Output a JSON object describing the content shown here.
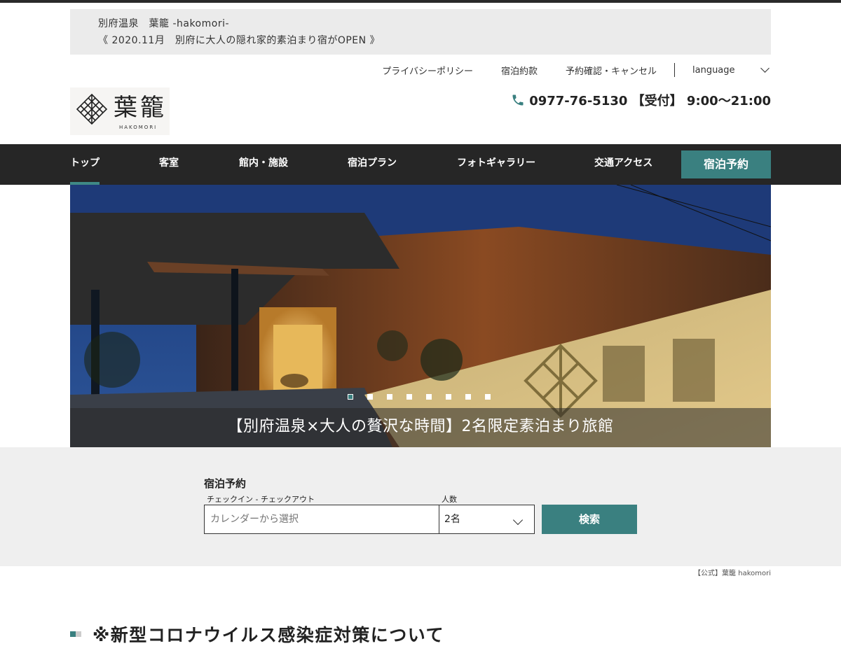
{
  "notice": {
    "line1": "別府温泉　葉籠 -hakomori-",
    "line2": "《 2020.11月　別府に大人の隠れ家的素泊まり宿がOPEN 》"
  },
  "utility": {
    "links": [
      "プライバシーポリシー",
      "宿泊約款",
      "予約確認・キャンセル"
    ],
    "language": "language"
  },
  "logo": {
    "kanji": "葉籠",
    "roman": "HAKOMORI"
  },
  "phone": {
    "text": "0977-76-5130 【受付】 9:00〜21:00",
    "icon": "phone-icon"
  },
  "nav": {
    "items": [
      "トップ",
      "客室",
      "館内・施設",
      "宿泊プラン",
      "フォトギャラリー",
      "交通アクセス"
    ],
    "active": "トップ",
    "reserve": "宿泊予約"
  },
  "hero": {
    "caption": "【別府温泉×大人の贅沢な時間】2名限定素泊まり旅館",
    "slide_count": 8,
    "active_slide": 1
  },
  "search": {
    "title": "宿泊予約",
    "checkin_label": "チェックイン - チェックアウト",
    "checkin_placeholder": "カレンダーから選択",
    "guests_label": "人数",
    "guests_value": "2名",
    "button": "検索"
  },
  "credit": "【公式】葉籠 hakomori",
  "section": {
    "title": "※新型コロナウイルス感染症対策について"
  },
  "colors": {
    "accent": "#3a8080",
    "nav_bg": "#262626",
    "notice_bg": "#ebebeb",
    "search_bg": "#efefef"
  }
}
